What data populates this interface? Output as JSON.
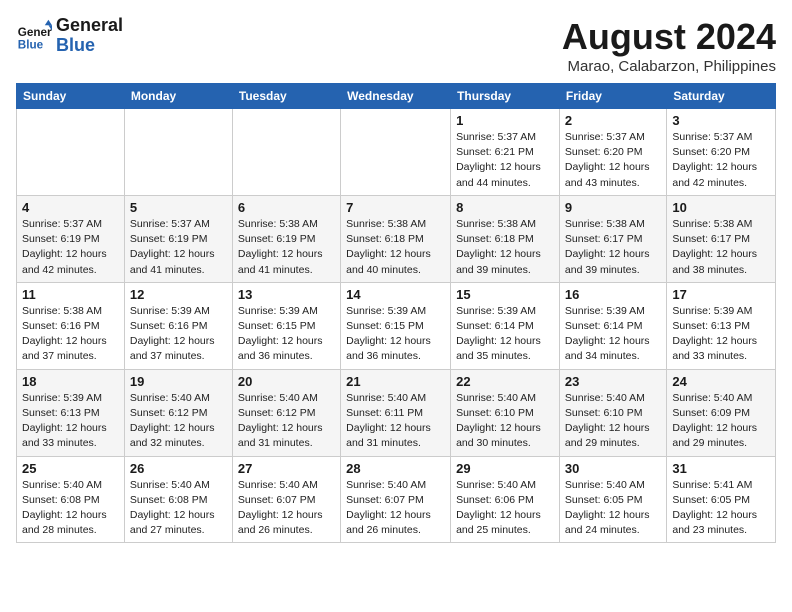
{
  "header": {
    "logo_line1": "General",
    "logo_line2": "Blue",
    "month_year": "August 2024",
    "location": "Marao, Calabarzon, Philippines"
  },
  "weekdays": [
    "Sunday",
    "Monday",
    "Tuesday",
    "Wednesday",
    "Thursday",
    "Friday",
    "Saturday"
  ],
  "weeks": [
    [
      {
        "day": "",
        "text": ""
      },
      {
        "day": "",
        "text": ""
      },
      {
        "day": "",
        "text": ""
      },
      {
        "day": "",
        "text": ""
      },
      {
        "day": "1",
        "text": "Sunrise: 5:37 AM\nSunset: 6:21 PM\nDaylight: 12 hours\nand 44 minutes."
      },
      {
        "day": "2",
        "text": "Sunrise: 5:37 AM\nSunset: 6:20 PM\nDaylight: 12 hours\nand 43 minutes."
      },
      {
        "day": "3",
        "text": "Sunrise: 5:37 AM\nSunset: 6:20 PM\nDaylight: 12 hours\nand 42 minutes."
      }
    ],
    [
      {
        "day": "4",
        "text": "Sunrise: 5:37 AM\nSunset: 6:19 PM\nDaylight: 12 hours\nand 42 minutes."
      },
      {
        "day": "5",
        "text": "Sunrise: 5:37 AM\nSunset: 6:19 PM\nDaylight: 12 hours\nand 41 minutes."
      },
      {
        "day": "6",
        "text": "Sunrise: 5:38 AM\nSunset: 6:19 PM\nDaylight: 12 hours\nand 41 minutes."
      },
      {
        "day": "7",
        "text": "Sunrise: 5:38 AM\nSunset: 6:18 PM\nDaylight: 12 hours\nand 40 minutes."
      },
      {
        "day": "8",
        "text": "Sunrise: 5:38 AM\nSunset: 6:18 PM\nDaylight: 12 hours\nand 39 minutes."
      },
      {
        "day": "9",
        "text": "Sunrise: 5:38 AM\nSunset: 6:17 PM\nDaylight: 12 hours\nand 39 minutes."
      },
      {
        "day": "10",
        "text": "Sunrise: 5:38 AM\nSunset: 6:17 PM\nDaylight: 12 hours\nand 38 minutes."
      }
    ],
    [
      {
        "day": "11",
        "text": "Sunrise: 5:38 AM\nSunset: 6:16 PM\nDaylight: 12 hours\nand 37 minutes."
      },
      {
        "day": "12",
        "text": "Sunrise: 5:39 AM\nSunset: 6:16 PM\nDaylight: 12 hours\nand 37 minutes."
      },
      {
        "day": "13",
        "text": "Sunrise: 5:39 AM\nSunset: 6:15 PM\nDaylight: 12 hours\nand 36 minutes."
      },
      {
        "day": "14",
        "text": "Sunrise: 5:39 AM\nSunset: 6:15 PM\nDaylight: 12 hours\nand 36 minutes."
      },
      {
        "day": "15",
        "text": "Sunrise: 5:39 AM\nSunset: 6:14 PM\nDaylight: 12 hours\nand 35 minutes."
      },
      {
        "day": "16",
        "text": "Sunrise: 5:39 AM\nSunset: 6:14 PM\nDaylight: 12 hours\nand 34 minutes."
      },
      {
        "day": "17",
        "text": "Sunrise: 5:39 AM\nSunset: 6:13 PM\nDaylight: 12 hours\nand 33 minutes."
      }
    ],
    [
      {
        "day": "18",
        "text": "Sunrise: 5:39 AM\nSunset: 6:13 PM\nDaylight: 12 hours\nand 33 minutes."
      },
      {
        "day": "19",
        "text": "Sunrise: 5:40 AM\nSunset: 6:12 PM\nDaylight: 12 hours\nand 32 minutes."
      },
      {
        "day": "20",
        "text": "Sunrise: 5:40 AM\nSunset: 6:12 PM\nDaylight: 12 hours\nand 31 minutes."
      },
      {
        "day": "21",
        "text": "Sunrise: 5:40 AM\nSunset: 6:11 PM\nDaylight: 12 hours\nand 31 minutes."
      },
      {
        "day": "22",
        "text": "Sunrise: 5:40 AM\nSunset: 6:10 PM\nDaylight: 12 hours\nand 30 minutes."
      },
      {
        "day": "23",
        "text": "Sunrise: 5:40 AM\nSunset: 6:10 PM\nDaylight: 12 hours\nand 29 minutes."
      },
      {
        "day": "24",
        "text": "Sunrise: 5:40 AM\nSunset: 6:09 PM\nDaylight: 12 hours\nand 29 minutes."
      }
    ],
    [
      {
        "day": "25",
        "text": "Sunrise: 5:40 AM\nSunset: 6:08 PM\nDaylight: 12 hours\nand 28 minutes."
      },
      {
        "day": "26",
        "text": "Sunrise: 5:40 AM\nSunset: 6:08 PM\nDaylight: 12 hours\nand 27 minutes."
      },
      {
        "day": "27",
        "text": "Sunrise: 5:40 AM\nSunset: 6:07 PM\nDaylight: 12 hours\nand 26 minutes."
      },
      {
        "day": "28",
        "text": "Sunrise: 5:40 AM\nSunset: 6:07 PM\nDaylight: 12 hours\nand 26 minutes."
      },
      {
        "day": "29",
        "text": "Sunrise: 5:40 AM\nSunset: 6:06 PM\nDaylight: 12 hours\nand 25 minutes."
      },
      {
        "day": "30",
        "text": "Sunrise: 5:40 AM\nSunset: 6:05 PM\nDaylight: 12 hours\nand 24 minutes."
      },
      {
        "day": "31",
        "text": "Sunrise: 5:41 AM\nSunset: 6:05 PM\nDaylight: 12 hours\nand 23 minutes."
      }
    ]
  ]
}
